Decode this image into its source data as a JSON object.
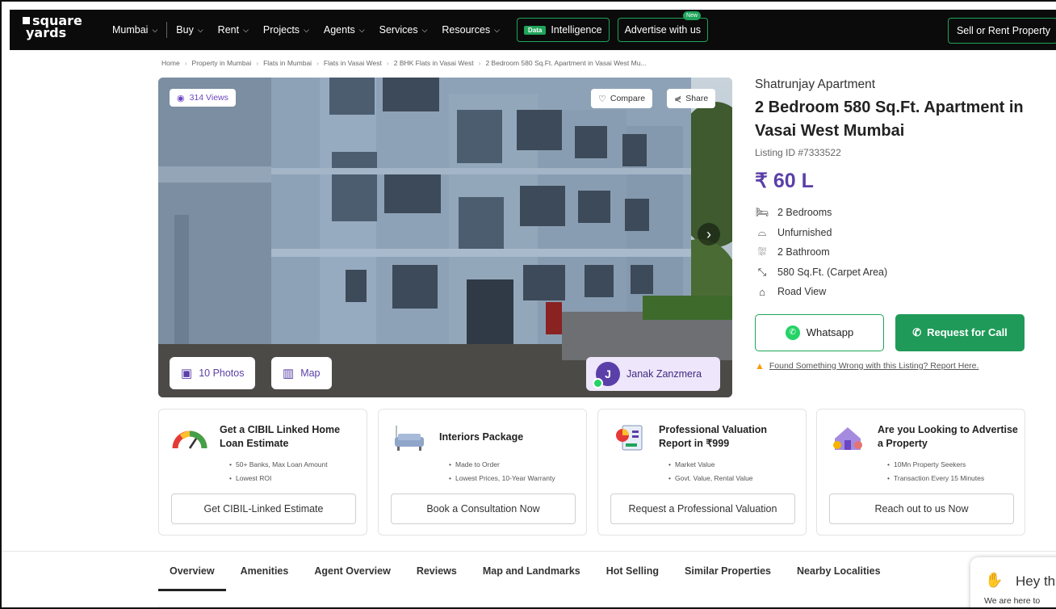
{
  "nav": {
    "logo_line1": "square",
    "logo_line2": "yards",
    "city": "Mumbai",
    "items": [
      "Buy",
      "Rent",
      "Projects",
      "Agents",
      "Services",
      "Resources"
    ],
    "data_badge": "Data",
    "intelligence": "Intelligence",
    "advertise": "Advertise with us",
    "new_badge": "New",
    "sell_rent": "Sell or Rent Property"
  },
  "breadcrumb": [
    "Home",
    "Property in Mumbai",
    "Flats in Mumbai",
    "Flats in Vasai West",
    "2 BHK Flats in Vasai West",
    "2 Bedroom 580 Sq.Ft. Apartment in Vasai West Mu..."
  ],
  "gallery": {
    "views": "314 Views",
    "compare": "Compare",
    "share": "Share",
    "photos": "10 Photos",
    "map": "Map",
    "agent_initial": "J",
    "agent_name": "Janak Zanzmera"
  },
  "listing": {
    "project": "Shatrunjay Apartment",
    "title": "2 Bedroom 580 Sq.Ft. Apartment in Vasai West Mumbai",
    "id": "Listing ID #7333522",
    "price": "₹ 60 L",
    "features": [
      {
        "icon": "bed-icon",
        "label": "2 Bedrooms"
      },
      {
        "icon": "sofa-icon",
        "label": "Unfurnished"
      },
      {
        "icon": "bath-icon",
        "label": "2 Bathroom"
      },
      {
        "icon": "area-icon",
        "label": "580 Sq.Ft. (Carpet Area)"
      },
      {
        "icon": "road-view-icon",
        "label": "Road View"
      }
    ],
    "whatsapp": "Whatsapp",
    "call": "Request for Call",
    "report": "Found Something Wrong with this Listing? Report Here."
  },
  "cards": [
    {
      "icon": "gauge-icon",
      "title": "Get a CIBIL Linked Home Loan Estimate",
      "bullets": [
        "50+ Banks, Max Loan Amount",
        "Lowest ROI"
      ],
      "button": "Get CIBIL-Linked Estimate"
    },
    {
      "icon": "sofa-lamp-icon",
      "title": "Interiors Package",
      "bullets": [
        "Made to Order",
        "Lowest Prices, 10-Year Warranty"
      ],
      "button": "Book a Consultation Now"
    },
    {
      "icon": "valuation-report-icon",
      "title": "Professional Valuation Report in ₹999",
      "bullets": [
        "Market Value",
        "Govt. Value, Rental Value"
      ],
      "button": "Request a Professional Valuation"
    },
    {
      "icon": "house-advertise-icon",
      "title": "Are you Looking to Advertise a Property",
      "bullets": [
        "10Mn Property Seekers",
        "Transaction Every 15 Minutes"
      ],
      "button": "Reach out to us Now"
    }
  ],
  "tabs": [
    "Overview",
    "Amenities",
    "Agent Overview",
    "Reviews",
    "Map and Landmarks",
    "Hot Selling",
    "Similar Properties",
    "Nearby Localities"
  ],
  "chat": {
    "greeting": "Hey th",
    "sub": "We are here to"
  },
  "colors": {
    "brand_purple": "#5b3fa8",
    "green": "#1f9a58",
    "nav_bg": "#0b0b0b"
  }
}
